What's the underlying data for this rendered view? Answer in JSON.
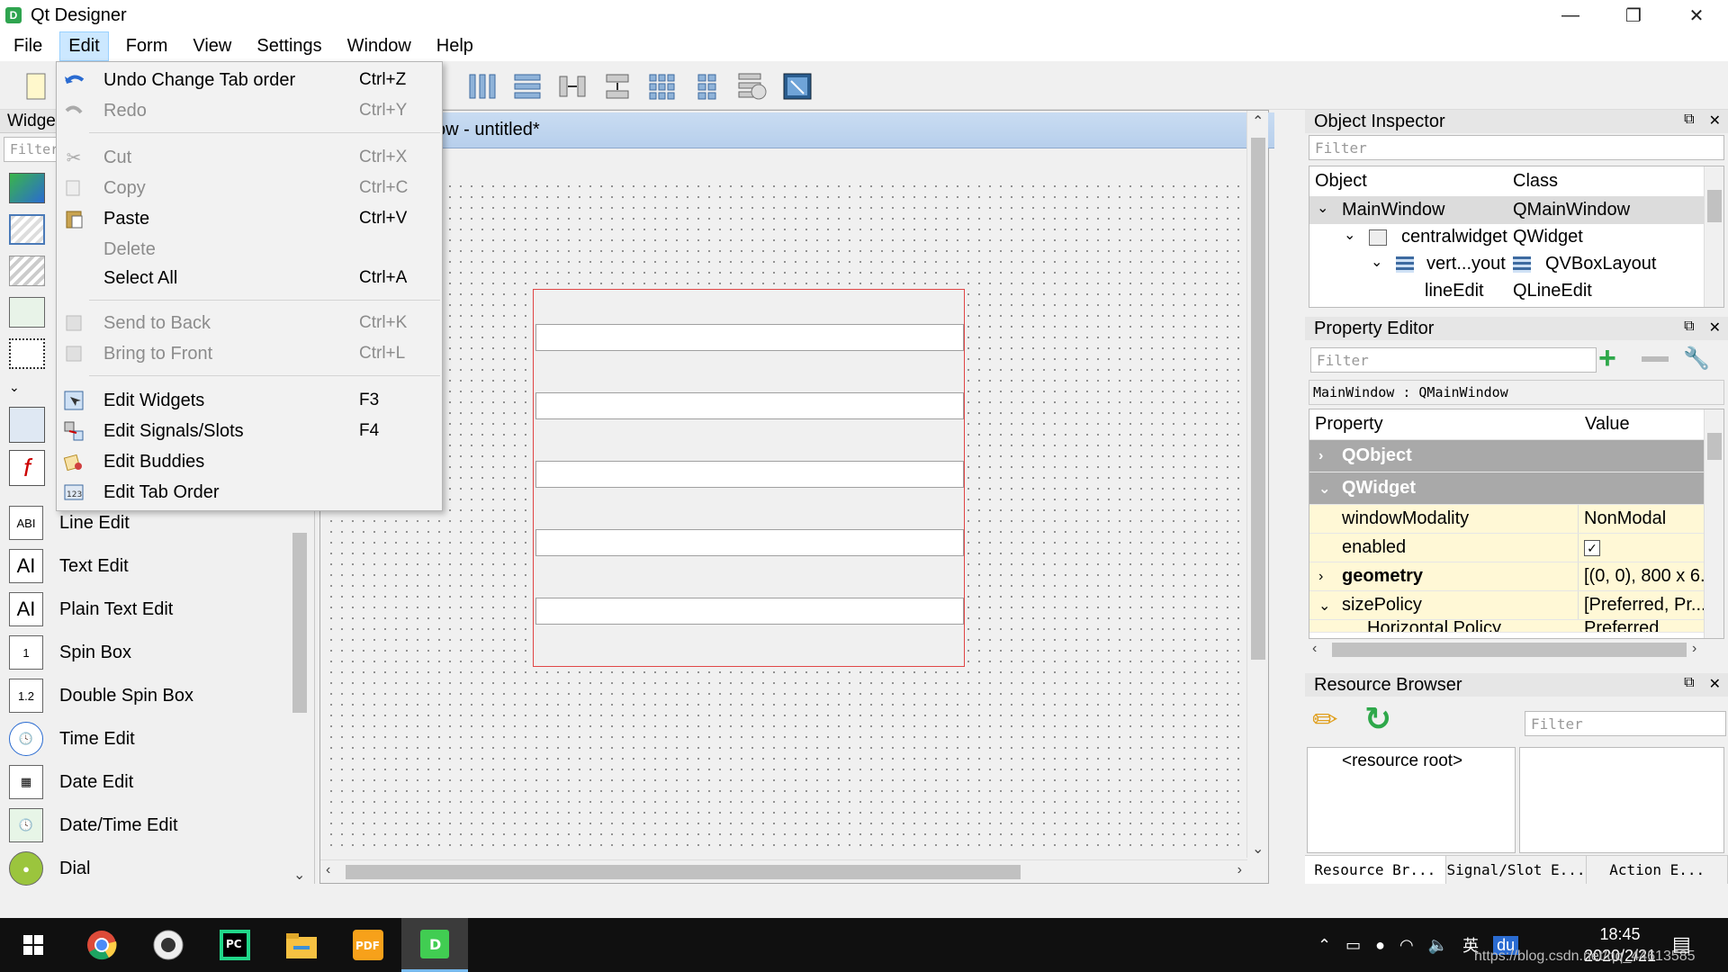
{
  "window": {
    "title": "Qt Designer",
    "app_icon_letter": "D",
    "minimize": "—",
    "maximize": "❐",
    "close": "✕"
  },
  "menubar": {
    "items": [
      "File",
      "Edit",
      "Form",
      "View",
      "Settings",
      "Window",
      "Help"
    ],
    "active": "Edit"
  },
  "edit_menu": {
    "items": [
      {
        "label": "Undo Change Tab order",
        "shortcut": "Ctrl+Z",
        "icon": "undo-icon",
        "enabled": true
      },
      {
        "label": "Redo",
        "shortcut": "Ctrl+Y",
        "icon": "redo-icon",
        "enabled": false
      },
      {
        "label": "Cut",
        "shortcut": "Ctrl+X",
        "icon": "scissors-icon",
        "enabled": false
      },
      {
        "label": "Copy",
        "shortcut": "Ctrl+C",
        "icon": "copy-icon",
        "enabled": false
      },
      {
        "label": "Paste",
        "shortcut": "Ctrl+V",
        "icon": "paste-icon",
        "enabled": true
      },
      {
        "label": "Delete",
        "shortcut": "",
        "icon": "",
        "enabled": false
      },
      {
        "label": "Select All",
        "shortcut": "Ctrl+A",
        "icon": "",
        "enabled": true
      },
      {
        "label": "Send to Back",
        "shortcut": "Ctrl+K",
        "icon": "send-back-icon",
        "enabled": false
      },
      {
        "label": "Bring to Front",
        "shortcut": "Ctrl+L",
        "icon": "bring-front-icon",
        "enabled": false
      },
      {
        "label": "Edit Widgets",
        "shortcut": "F3",
        "icon": "edit-widgets-icon",
        "enabled": true
      },
      {
        "label": "Edit Signals/Slots",
        "shortcut": "F4",
        "icon": "signals-slots-icon",
        "enabled": true
      },
      {
        "label": "Edit Buddies",
        "shortcut": "",
        "icon": "buddies-icon",
        "enabled": true
      },
      {
        "label": "Edit Tab Order",
        "shortcut": "",
        "icon": "tab-order-icon",
        "enabled": true
      }
    ]
  },
  "widget_box": {
    "title": "Widge",
    "filter_placeholder": "Filter",
    "items": [
      {
        "label": "Line Edit",
        "icon_text": "ABI"
      },
      {
        "label": "Text Edit",
        "icon_text": "AI"
      },
      {
        "label": "Plain Text Edit",
        "icon_text": "AI"
      },
      {
        "label": "Spin Box",
        "icon_text": "1"
      },
      {
        "label": "Double Spin Box",
        "icon_text": "1.2"
      },
      {
        "label": "Time Edit",
        "icon_text": "🕓"
      },
      {
        "label": "Date Edit",
        "icon_text": "▦"
      },
      {
        "label": "Date/Time Edit",
        "icon_text": "🕓"
      },
      {
        "label": "Dial",
        "icon_text": "●"
      }
    ]
  },
  "form": {
    "title": "ow - untitled*",
    "line_edit_count": 5
  },
  "object_inspector": {
    "title": "Object Inspector",
    "filter_placeholder": "Filter",
    "headers": [
      "Object",
      "Class"
    ],
    "rows": [
      {
        "object": "MainWindow",
        "class": "QMainWindow"
      },
      {
        "object": "centralwidget",
        "class": "QWidget"
      },
      {
        "object": "vert...yout",
        "class": "QVBoxLayout"
      },
      {
        "object": "lineEdit",
        "class": "QLineEdit"
      }
    ]
  },
  "property_editor": {
    "title": "Property Editor",
    "filter_placeholder": "Filter",
    "context": "MainWindow : QMainWindow",
    "headers": [
      "Property",
      "Value"
    ],
    "rows": [
      {
        "property": "QObject",
        "value": "",
        "group": true
      },
      {
        "property": "QWidget",
        "value": "",
        "group": true
      },
      {
        "property": "windowModality",
        "value": "NonModal"
      },
      {
        "property": "enabled",
        "value": "✓"
      },
      {
        "property": "geometry",
        "value": "[(0, 0), 800 x 6..."
      },
      {
        "property": "sizePolicy",
        "value": "[Preferred, Pr..."
      },
      {
        "property": "Horizontal Policy",
        "value": "Preferred"
      }
    ]
  },
  "resource_browser": {
    "title": "Resource Browser",
    "filter_placeholder": "Filter",
    "root": "<resource root>"
  },
  "bottom_tabs": [
    "Resource Br...",
    "Signal/Slot E...",
    "Action E..."
  ],
  "taskbar": {
    "time": "18:45",
    "date": "2020/2/21",
    "watermark": "https://blog.csdn.net/qq_44613585",
    "ime": "英"
  }
}
